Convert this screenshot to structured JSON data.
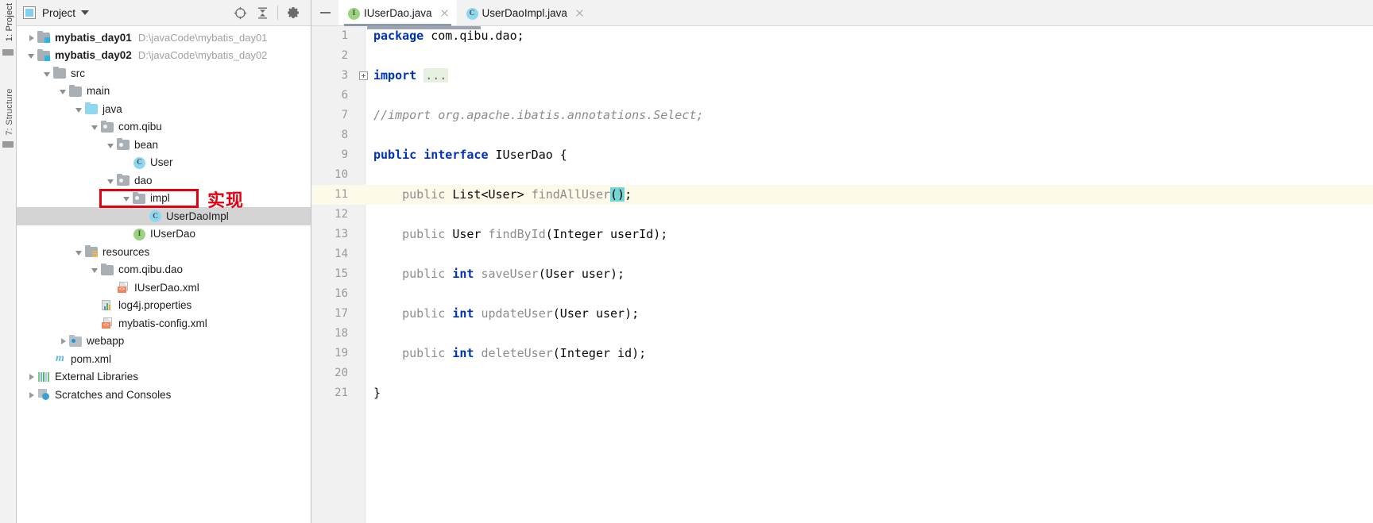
{
  "left_strip": {
    "tabs": [
      {
        "label": "1: Project"
      },
      {
        "label": "7: Structure"
      }
    ]
  },
  "project_panel": {
    "title": "Project",
    "icons": {
      "project_view": "project-view-icon",
      "locate": "locate-target-icon",
      "collapse_all": "collapse-all-icon",
      "settings": "gear-icon",
      "dropdown": "chevron-down-icon"
    },
    "tree": [
      {
        "label": "mybatis_day01",
        "path": "D:\\javaCode\\mybatis_day01",
        "icon": "module-folder-icon",
        "indent": 0,
        "arrow": "right",
        "bold": true,
        "selected": false
      },
      {
        "label": "mybatis_day02",
        "path": "D:\\javaCode\\mybatis_day02",
        "icon": "module-folder-icon",
        "indent": 0,
        "arrow": "down",
        "bold": true,
        "selected": false
      },
      {
        "label": "src",
        "path": "",
        "icon": "folder-icon",
        "indent": 1,
        "arrow": "down",
        "bold": false,
        "selected": false
      },
      {
        "label": "main",
        "path": "",
        "icon": "folder-icon",
        "indent": 2,
        "arrow": "down",
        "bold": false,
        "selected": false
      },
      {
        "label": "java",
        "path": "",
        "icon": "source-folder-icon",
        "indent": 3,
        "arrow": "down",
        "bold": false,
        "selected": false
      },
      {
        "label": "com.qibu",
        "path": "",
        "icon": "package-icon",
        "indent": 4,
        "arrow": "down",
        "bold": false,
        "selected": false
      },
      {
        "label": "bean",
        "path": "",
        "icon": "package-icon",
        "indent": 5,
        "arrow": "down",
        "bold": false,
        "selected": false
      },
      {
        "label": "User",
        "path": "",
        "icon": "java-class-icon",
        "indent": 6,
        "arrow": "none",
        "bold": false,
        "selected": false
      },
      {
        "label": "dao",
        "path": "",
        "icon": "package-icon",
        "indent": 5,
        "arrow": "down",
        "bold": false,
        "selected": false
      },
      {
        "label": "impl",
        "path": "",
        "icon": "package-icon",
        "indent": 6,
        "arrow": "down",
        "bold": false,
        "selected": false
      },
      {
        "label": "UserDaoImpl",
        "path": "",
        "icon": "java-class-icon",
        "indent": 7,
        "arrow": "none",
        "bold": false,
        "selected": true
      },
      {
        "label": "IUserDao",
        "path": "",
        "icon": "java-interface-icon",
        "indent": 6,
        "arrow": "none",
        "bold": false,
        "selected": false
      },
      {
        "label": "resources",
        "path": "",
        "icon": "resources-folder-icon",
        "indent": 3,
        "arrow": "down",
        "bold": false,
        "selected": false
      },
      {
        "label": "com.qibu.dao",
        "path": "",
        "icon": "folder-icon",
        "indent": 4,
        "arrow": "down",
        "bold": false,
        "selected": false
      },
      {
        "label": "IUserDao.xml",
        "path": "",
        "icon": "xml-file-icon",
        "indent": 5,
        "arrow": "none",
        "bold": false,
        "selected": false
      },
      {
        "label": "log4j.properties",
        "path": "",
        "icon": "properties-file-icon",
        "indent": 4,
        "arrow": "none",
        "bold": false,
        "selected": false
      },
      {
        "label": "mybatis-config.xml",
        "path": "",
        "icon": "xml-file-icon",
        "indent": 4,
        "arrow": "none",
        "bold": false,
        "selected": false
      },
      {
        "label": "webapp",
        "path": "",
        "icon": "webapp-folder-icon",
        "indent": 2,
        "arrow": "right",
        "bold": false,
        "selected": false
      },
      {
        "label": "pom.xml",
        "path": "",
        "icon": "maven-icon",
        "indent": 1,
        "arrow": "none",
        "bold": false,
        "selected": false
      },
      {
        "label": "External Libraries",
        "path": "",
        "icon": "libraries-icon",
        "indent": 0,
        "arrow": "right",
        "bold": false,
        "selected": false
      },
      {
        "label": "Scratches and Consoles",
        "path": "",
        "icon": "scratches-icon",
        "indent": 0,
        "arrow": "right",
        "bold": false,
        "selected": false
      }
    ]
  },
  "annotation": {
    "text": "实现",
    "color": "#e3000f",
    "target_label": "impl"
  },
  "editor": {
    "tabs": [
      {
        "label": "IUserDao.java",
        "icon": "java-interface-icon",
        "active": true,
        "close": "close-icon"
      },
      {
        "label": "UserDaoImpl.java",
        "icon": "java-class-icon",
        "active": false,
        "close": "close-icon"
      }
    ],
    "minimize_button": "minimize-icon",
    "caret_line": 11,
    "lines": [
      {
        "num": "1",
        "fold": false,
        "segments": [
          {
            "t": "package ",
            "c": "kw"
          },
          {
            "t": "com.qibu.dao;",
            "c": "plain"
          }
        ]
      },
      {
        "num": "2",
        "fold": false,
        "segments": []
      },
      {
        "num": "3",
        "fold": true,
        "segments": [
          {
            "t": "import ",
            "c": "kw"
          },
          {
            "t": "...",
            "c": "foldtxt"
          }
        ]
      },
      {
        "num": "6",
        "fold": false,
        "segments": []
      },
      {
        "num": "7",
        "fold": false,
        "segments": [
          {
            "t": "//import org.apache.ibatis.annotations.Select;",
            "c": "cmt"
          }
        ]
      },
      {
        "num": "8",
        "fold": false,
        "segments": []
      },
      {
        "num": "9",
        "fold": false,
        "segments": [
          {
            "t": "public interface ",
            "c": "kw"
          },
          {
            "t": "IUserDao {",
            "c": "plain"
          }
        ]
      },
      {
        "num": "10",
        "fold": false,
        "segments": []
      },
      {
        "num": "11",
        "fold": false,
        "segments": [
          {
            "t": "    ",
            "c": "plain"
          },
          {
            "t": "public ",
            "c": "ident"
          },
          {
            "t": "List<User> ",
            "c": "plain"
          },
          {
            "t": "findAllUser",
            "c": "ident"
          },
          {
            "t": "()",
            "c": "bracket-hl"
          },
          {
            "t": ";",
            "c": "plain"
          }
        ]
      },
      {
        "num": "12",
        "fold": false,
        "segments": []
      },
      {
        "num": "13",
        "fold": false,
        "segments": [
          {
            "t": "    ",
            "c": "plain"
          },
          {
            "t": "public ",
            "c": "ident"
          },
          {
            "t": "User ",
            "c": "plain"
          },
          {
            "t": "findById",
            "c": "ident"
          },
          {
            "t": "(Integer userId);",
            "c": "plain"
          }
        ]
      },
      {
        "num": "14",
        "fold": false,
        "segments": []
      },
      {
        "num": "15",
        "fold": false,
        "segments": [
          {
            "t": "    ",
            "c": "plain"
          },
          {
            "t": "public ",
            "c": "ident"
          },
          {
            "t": "int ",
            "c": "kw"
          },
          {
            "t": "saveUser",
            "c": "ident"
          },
          {
            "t": "(User user);",
            "c": "plain"
          }
        ]
      },
      {
        "num": "16",
        "fold": false,
        "segments": []
      },
      {
        "num": "17",
        "fold": false,
        "segments": [
          {
            "t": "    ",
            "c": "plain"
          },
          {
            "t": "public ",
            "c": "ident"
          },
          {
            "t": "int ",
            "c": "kw"
          },
          {
            "t": "updateUser",
            "c": "ident"
          },
          {
            "t": "(User user);",
            "c": "plain"
          }
        ]
      },
      {
        "num": "18",
        "fold": false,
        "segments": []
      },
      {
        "num": "19",
        "fold": false,
        "segments": [
          {
            "t": "    ",
            "c": "plain"
          },
          {
            "t": "public ",
            "c": "ident"
          },
          {
            "t": "int ",
            "c": "kw"
          },
          {
            "t": "deleteUser",
            "c": "ident"
          },
          {
            "t": "(Integer id);",
            "c": "plain"
          }
        ]
      },
      {
        "num": "20",
        "fold": false,
        "segments": []
      },
      {
        "num": "21",
        "fold": false,
        "segments": [
          {
            "t": "}",
            "c": "plain"
          }
        ]
      }
    ]
  },
  "colors": {
    "selection": "#d4d4d4",
    "caret_line": "#fdfaea",
    "bracket_match": "#75d5d5",
    "fold_placeholder": "#e5f0e0",
    "keyword": "#0033b3",
    "comment": "#8c8c8c",
    "annotation_red": "#e3000f"
  }
}
